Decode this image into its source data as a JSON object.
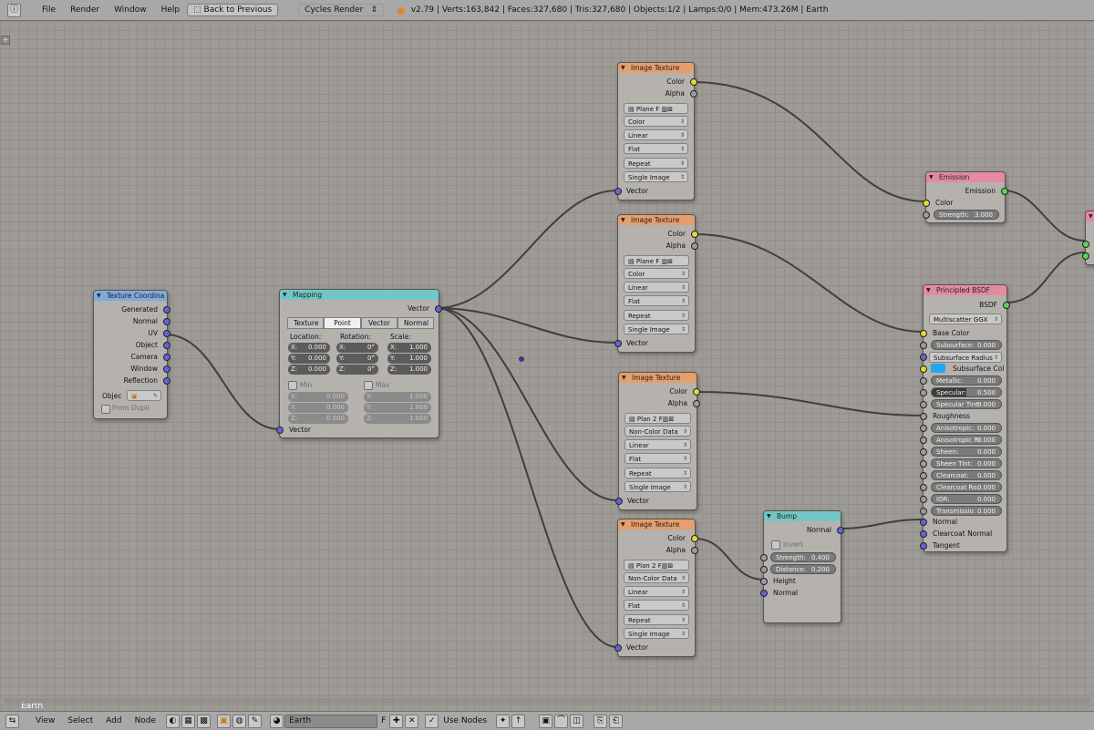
{
  "topbar": {
    "menus": [
      "File",
      "Render",
      "Window",
      "Help"
    ],
    "back_button": "Back to Previous",
    "engine": "Cycles Render",
    "stats": "v2.79 | Verts:163,842 | Faces:327,680 | Tris:327,680 | Objects:1/2 | Lamps:0/0 | Mem:473.26M | Earth"
  },
  "scene_label": "Earth",
  "texcoord": {
    "title": "Texture Coordina",
    "outputs": [
      "Generated",
      "Normal",
      "UV",
      "Object",
      "Camera",
      "Window",
      "Reflection"
    ],
    "object_label": "Objec",
    "from_dupli": "From Dupli"
  },
  "mapping": {
    "title": "Mapping",
    "output": "Vector",
    "tabs": [
      "Texture",
      "Point",
      "Vector",
      "Normal"
    ],
    "location_label": "Location:",
    "rotation_label": "Rotation:",
    "scale_label": "Scale:",
    "loc": [
      {
        "a": "X:",
        "v": "0.000"
      },
      {
        "a": "Y:",
        "v": "0.000"
      },
      {
        "a": "Z:",
        "v": "0.000"
      }
    ],
    "rot": [
      {
        "a": "X:",
        "v": "0°"
      },
      {
        "a": "Y:",
        "v": "0°"
      },
      {
        "a": "Z:",
        "v": "0°"
      }
    ],
    "scl": [
      {
        "a": "X:",
        "v": "1.000"
      },
      {
        "a": "Y:",
        "v": "1.000"
      },
      {
        "a": "Z:",
        "v": "1.000"
      }
    ],
    "min_label": "Min",
    "max_label": "Max",
    "min": [
      {
        "a": "X:",
        "v": "0.000"
      },
      {
        "a": "Y:",
        "v": "0.000"
      },
      {
        "a": "Z:",
        "v": "0.000"
      }
    ],
    "max": [
      {
        "a": "X:",
        "v": "1.000"
      },
      {
        "a": "Y:",
        "v": "1.000"
      },
      {
        "a": "Z:",
        "v": "1.000"
      }
    ],
    "input": "Vector"
  },
  "img1": {
    "title": "Image Texture",
    "out_color": "Color",
    "out_alpha": "Alpha",
    "image": "Plane",
    "flag": "F",
    "color": "Color",
    "interp": "Linear",
    "proj": "Flat",
    "ext": "Repeat",
    "source": "Single Image",
    "in_vector": "Vector"
  },
  "img2": {
    "title": "Image Texture",
    "out_color": "Color",
    "out_alpha": "Alpha",
    "image": "Plane",
    "flag": "F",
    "color": "Color",
    "interp": "Linear",
    "proj": "Flat",
    "ext": "Repeat",
    "source": "Single Image",
    "in_vector": "Vector"
  },
  "img3": {
    "title": "Image Texture",
    "out_color": "Color",
    "out_alpha": "Alpha",
    "image": "Plan",
    "users": "2",
    "flag": "F",
    "color": "Non-Color Data",
    "interp": "Linear",
    "proj": "Flat",
    "ext": "Repeat",
    "source": "Single Image",
    "in_vector": "Vector"
  },
  "img4": {
    "title": "Image Texture",
    "out_color": "Color",
    "out_alpha": "Alpha",
    "image": "Plan",
    "users": "2",
    "flag": "F",
    "color": "Non-Color Data",
    "interp": "Linear",
    "proj": "Flat",
    "ext": "Repeat",
    "source": "Single Image",
    "in_vector": "Vector"
  },
  "emission": {
    "title": "Emission",
    "output": "Emission",
    "in_color": "Color",
    "strength_label": "Strength:",
    "strength": "3.000"
  },
  "bump": {
    "title": "Bump",
    "output": "Normal",
    "invert": "Invert",
    "strength_label": "Strength:",
    "strength": "0.400",
    "distance_label": "Distance:",
    "distance": "0.200",
    "in_height": "Height",
    "in_normal": "Normal"
  },
  "bsdf": {
    "title": "Principled BSDF",
    "output": "BSDF",
    "distribution": "Multiscatter GGX",
    "base_color": "Base Color",
    "subsurface_label": "Subsurface:",
    "subsurface": "0.000",
    "subsurface_radius": "Subsurface Radius",
    "subsurface_col": "Subsurface Col",
    "subsurface_col_swatch": "#22a8f0",
    "metallic_label": "Metallic:",
    "metallic": "0.000",
    "specular_label": "Specular:",
    "specular": "0.500",
    "spectint_label": "Specular Tint:",
    "spectint": "0.000",
    "roughness": "Roughness",
    "aniso_label": "Anisotropic:",
    "aniso": "0.000",
    "anisorot_label": "Anisotropic R:",
    "anisorot": "0.000",
    "sheen_label": "Sheen:",
    "sheen": "0.000",
    "sheentint_label": "Sheen Tint:",
    "sheentint": "0.000",
    "clearcoat_label": "Clearcoat:",
    "clearcoat": "0.000",
    "clearcoatro_label": "Clearcoat Ro:",
    "clearcoatro": "0.000",
    "ior_label": "IOR:",
    "ior": "0.000",
    "trans_label": "Transmissio:",
    "trans": "0.000",
    "normal": "Normal",
    "clearcoat_normal": "Clearcoat Normal",
    "tangent": "Tangent"
  },
  "bottombar": {
    "menus": [
      "View",
      "Select",
      "Add",
      "Node"
    ],
    "material": "Earth",
    "material_flag": "F",
    "use_nodes": "Use Nodes"
  }
}
